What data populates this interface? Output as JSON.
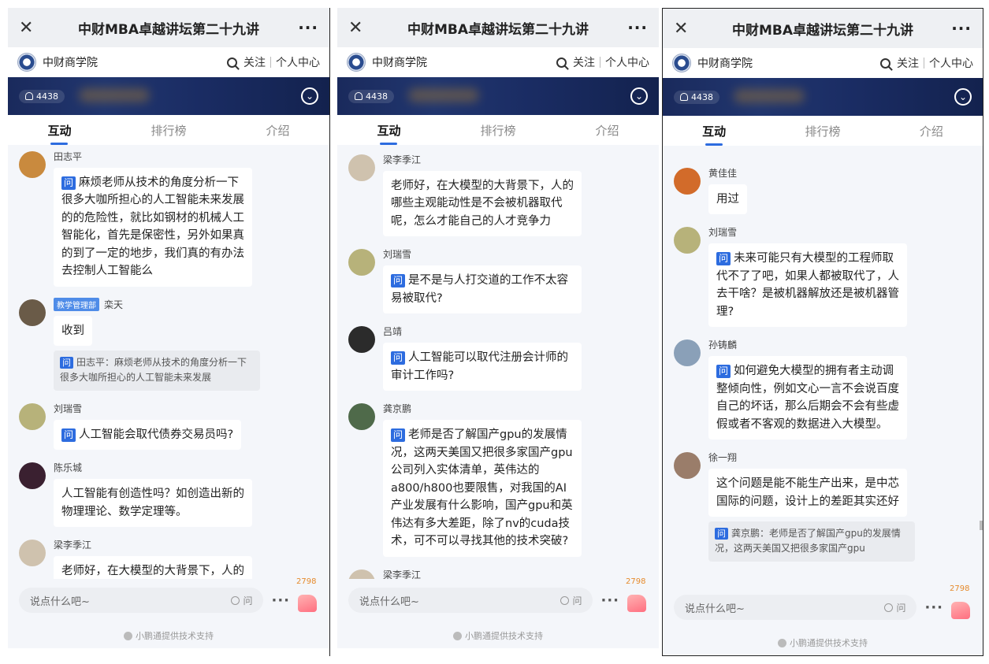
{
  "header": {
    "title": "中财MBA卓越讲坛第二十九讲",
    "more": "···",
    "close": "✕"
  },
  "org": {
    "name": "中财商学院",
    "follow": "关注",
    "profile": "个人中心"
  },
  "banner": {
    "viewers": "4438"
  },
  "tabs": [
    "互动",
    "排行榜",
    "介绍"
  ],
  "bottom": {
    "placeholder": "说点什么吧~",
    "ask_label": "问",
    "like_count": "2798",
    "powered_by": "小鹏通提供技术支持"
  },
  "panels": [
    {
      "messages": [
        {
          "name": "田志平",
          "q": true,
          "text": "麻烦老师从技术的角度分析一下很多大咖所担心的人工智能未来发展的的危险性，就比如钢材的机械人工智能化，首先是保密性，另外如果真的到了一定的地步，我们真的有办法去控制人工智能么"
        },
        {
          "name": "栾天",
          "badge": "教学管理部",
          "q": false,
          "text": "收到",
          "quote": "田志平：麻烦老师从技术的角度分析一下很多大咖所担心的人工智能未来发展"
        },
        {
          "name": "刘瑞雪",
          "q": true,
          "text": "人工智能会取代债券交易员吗?"
        },
        {
          "name": "陈乐城",
          "q": false,
          "text": "人工智能有创造性吗？如创造出新的物理理论、数学定理等。"
        },
        {
          "name": "梁李季江",
          "q": false,
          "text": "老师好，在大模型的大背景下，人的"
        }
      ]
    },
    {
      "messages": [
        {
          "name": "梁李季江",
          "q": false,
          "text": "老师好，在大模型的大背景下，人的哪些主观能动性是不会被机器取代呢，怎么才能自己的人才竞争力"
        },
        {
          "name": "刘瑞雪",
          "q": true,
          "text": "是不是与人打交道的工作不太容易被取代?"
        },
        {
          "name": "吕靖",
          "q": true,
          "text": "人工智能可以取代注册会计师的审计工作吗?"
        },
        {
          "name": "龚京鹏",
          "q": true,
          "text": "老师是否了解国产gpu的发展情况，这两天美国又把很多家国产gpu公司列入实体清单，英伟达的a800/h800也要限售，对我国的AI产业发展有什么影响，国产gpu和英伟达有多大差距，除了nv的cuda技术，可不可以寻找其他的技术突破?"
        },
        {
          "name": "梁李季江",
          "q": false,
          "text": ""
        }
      ]
    },
    {
      "messages": [
        {
          "name": "黄佳佳",
          "q": false,
          "text": "用过"
        },
        {
          "name": "刘瑞雪",
          "q": true,
          "text": "未来可能只有大模型的工程师取代不了了吧，如果人都被取代了，人去干啥？是被机器解放还是被机器管理?"
        },
        {
          "name": "孙铸麟",
          "q": true,
          "text": "如何避免大模型的拥有者主动调整倾向性，例如文心一言不会说百度自己的坏话，那么后期会不会有些虚假或者不客观的数据进入大模型。"
        },
        {
          "name": "徐一翔",
          "q": false,
          "text": "这个问题是能不能生产出来，是中芯国际的问题，设计上的差距其实还好",
          "quote": "龚京鹏：老师是否了解国产gpu的发展情况，这两天美国又把很多家国产gpu"
        }
      ]
    }
  ]
}
